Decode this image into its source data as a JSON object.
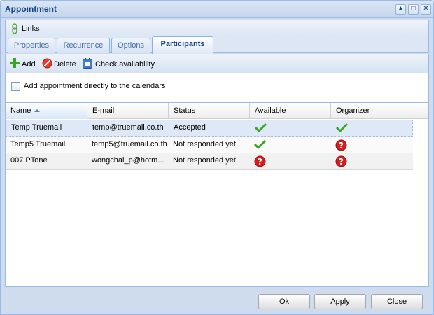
{
  "window": {
    "title": "Appointment",
    "tools": [
      "▲",
      "□",
      "✕"
    ]
  },
  "links": {
    "label": "Links"
  },
  "tabs": [
    {
      "label": "Properties"
    },
    {
      "label": "Recurrence"
    },
    {
      "label": "Options"
    },
    {
      "label": "Participants",
      "active": true
    }
  ],
  "toolbar": {
    "add_label": "Add",
    "delete_label": "Delete",
    "check_label": "Check availability"
  },
  "option": {
    "label": "Add appointment directly to the calendars",
    "checked": false
  },
  "grid": {
    "columns": [
      "Name",
      "E-mail",
      "Status",
      "Available",
      "Organizer"
    ],
    "sorted_column": "Name",
    "rows": [
      {
        "name": "Temp Truemail",
        "email": "temp@truemail.co.th",
        "status": "Accepted",
        "available": "check-icon",
        "organizer": "check-icon"
      },
      {
        "name": "Temp5 Truemail",
        "email": "temp5@truemail.co.th",
        "status": "Not responded yet",
        "available": "check-icon",
        "organizer": "question-icon"
      },
      {
        "name": "007 PTone",
        "email": "wongchai_p@hotm...",
        "status": "Not responded yet",
        "available": "question-icon",
        "organizer": "question-icon"
      }
    ]
  },
  "footer": {
    "ok_label": "Ok",
    "apply_label": "Apply",
    "close_label": "Close"
  },
  "colors": {
    "header_blue": "#15428b",
    "border_blue": "#99bbe8",
    "panel_bg": "#cfdcee",
    "check_green": "#3aa524",
    "question_red": "#d81c1c"
  }
}
